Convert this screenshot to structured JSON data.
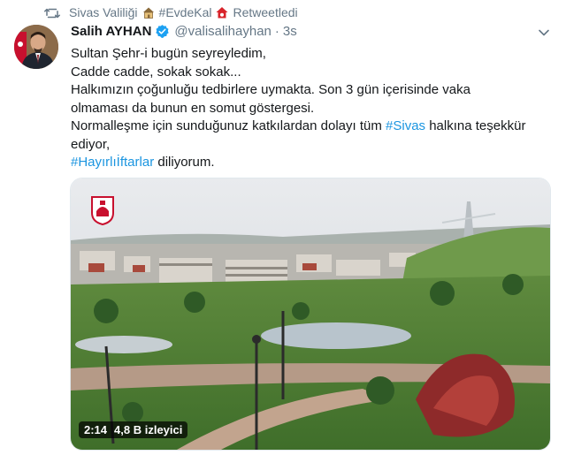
{
  "retweet": {
    "account": "Sivas Valiliği",
    "hashtag": "#EvdeKal",
    "suffix": "Retweetledi"
  },
  "author": {
    "name": "Salih AYHAN",
    "handle": "@valisalihayhan",
    "separator": "·",
    "time": "3s"
  },
  "text": {
    "line1": "Sultan Şehr-i bugün seyreyledim,",
    "line2": "Cadde cadde, sokak sokak...",
    "line3": "Halkımızın çoğunluğu tedbirlere uymakta. Son 3 gün içerisinde vaka",
    "line4": "olmaması da bunun en somut göstergesi.",
    "line5_pre": "Normalleşme için sunduğunuz katkılardan dolayı tüm ",
    "line5_tag": "#Sivas",
    "line5_post": " halkına teşekkür",
    "line6": "ediyor,",
    "line7_tag": "#Hayırlıİftarlar",
    "line7_post": " diliyorum."
  },
  "video": {
    "duration": "2:14",
    "views": "4,8 B izleyici"
  },
  "colors": {
    "link": "#1b95e0",
    "muted": "#657786",
    "verified": "#1da1f2"
  }
}
